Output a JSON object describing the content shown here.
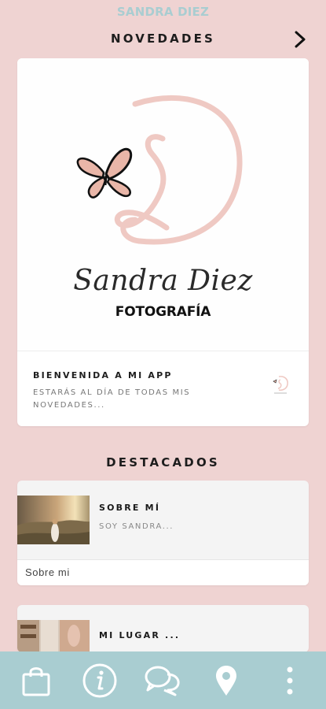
{
  "header": {
    "app_title": "SANDRA DIEZ"
  },
  "news": {
    "section_title": "NOVEDADES",
    "logo_script": "Sandra Diez",
    "logo_subtitle": "FOTOGRAFÍA",
    "post_title": "BIENVENIDA A MI APP",
    "post_description": "ESTARÁS AL DÍA DE TODAS MIS NOVEDADES..."
  },
  "featured": {
    "section_title": "DESTACADOS",
    "items": [
      {
        "title": "SOBRE MÍ",
        "description": "SOY SANDRA...",
        "footer_label": "Sobre mi"
      },
      {
        "title": "MI LUGAR ..."
      }
    ]
  },
  "bottom_nav": {
    "icons": [
      "shopping-bag-icon",
      "info-icon",
      "chat-icon",
      "location-pin-icon",
      "more-vertical-icon"
    ]
  },
  "colors": {
    "background": "#efd3d2",
    "accent": "#a9cdd1",
    "logo_pink": "#efc9c3"
  }
}
